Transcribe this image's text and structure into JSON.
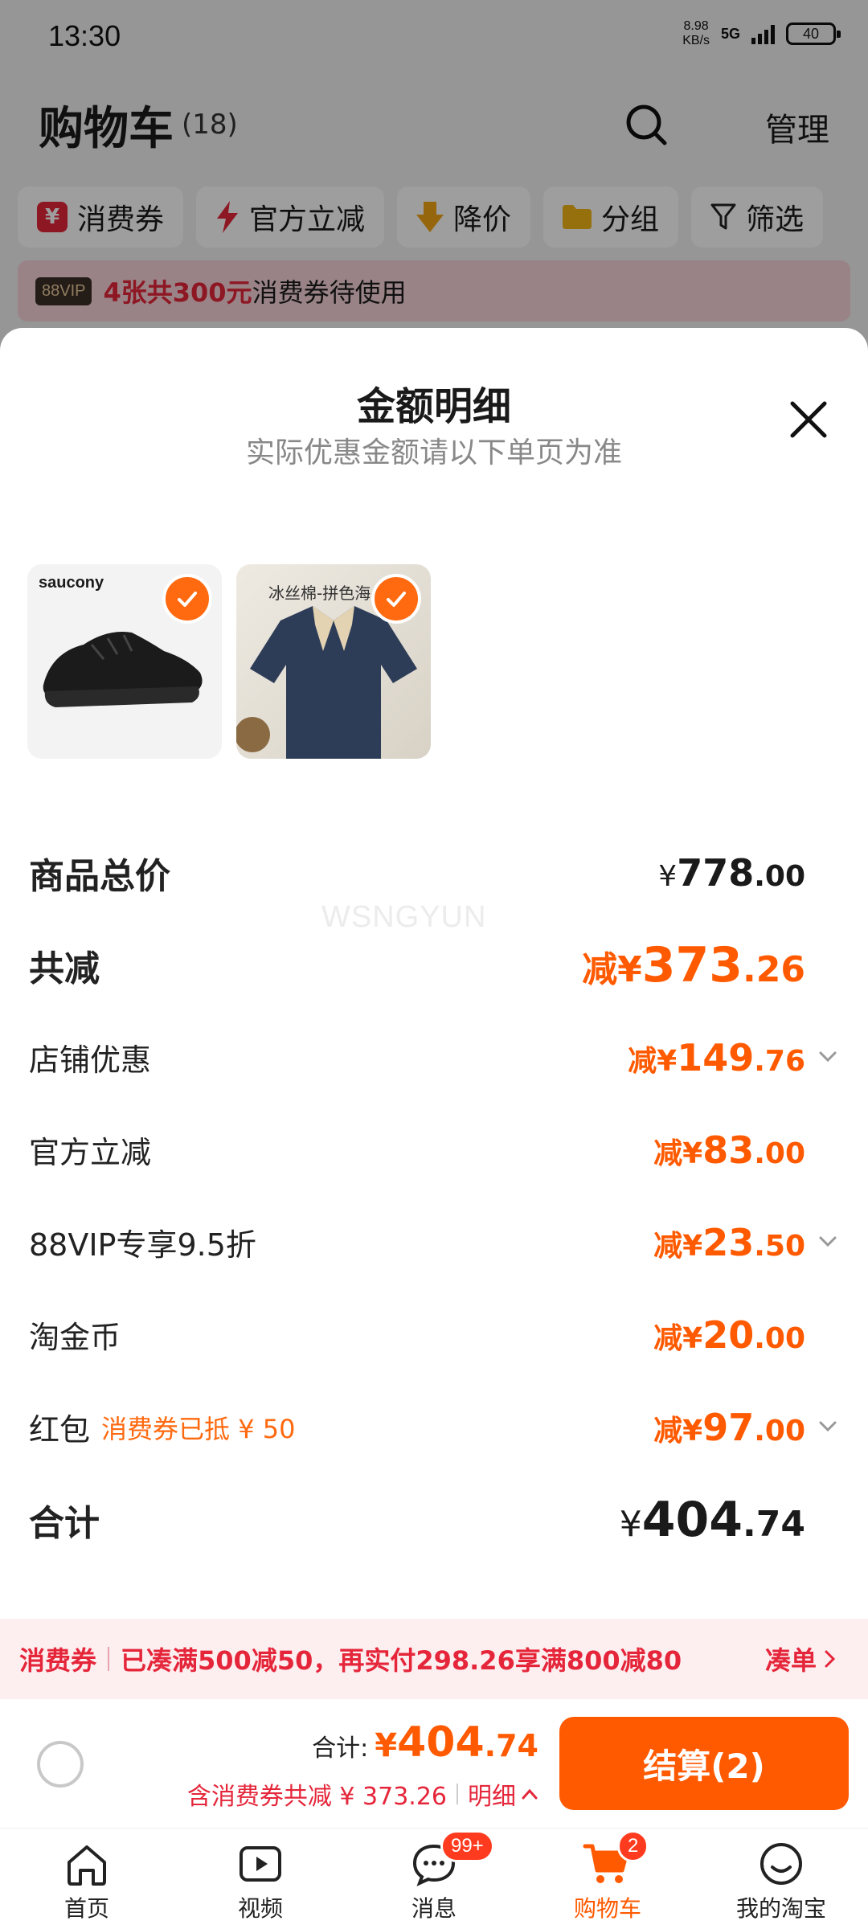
{
  "status_bar": {
    "time": "13:30",
    "net_speed_line1": "8.98",
    "net_speed_line2": "KB/s",
    "network": "5G",
    "battery": "40"
  },
  "cart_header": {
    "title": "购物车",
    "count": "(18)",
    "manage_label": "管理"
  },
  "filters": [
    {
      "label": "消费券",
      "icon": "coupon-yen-icon",
      "color": "#e5263a"
    },
    {
      "label": "官方立减",
      "icon": "lightning-icon",
      "color": "#e5263a"
    },
    {
      "label": "降价",
      "icon": "down-arrow-icon",
      "color": "#f2a516"
    },
    {
      "label": "分组",
      "icon": "folder-icon",
      "color": "#f2b516"
    },
    {
      "label": "筛选",
      "icon": "filter-funnel-icon",
      "color": "#222222"
    }
  ],
  "vip_banner": {
    "tag": "88VIP",
    "highlight": "4张共300元",
    "text": "消费券待使用"
  },
  "sheet": {
    "title": "金额明细",
    "subtitle": "实际优惠金额请以下单页为准",
    "products": [
      {
        "name": "saucony black running shoes",
        "brand": "saucony",
        "checked": true
      },
      {
        "name": "navy polo shirt",
        "label": "冰丝棉-拼色海",
        "checked": true
      }
    ],
    "rows": [
      {
        "label": "商品总价",
        "prefix": "¥",
        "int": "778",
        "dec": ".00"
      },
      {
        "label": "共减",
        "prefix": "减¥",
        "int": "373",
        "dec": ".26"
      },
      {
        "label": "店铺优惠",
        "prefix": "减¥",
        "int": "149",
        "dec": ".76"
      },
      {
        "label": "官方立减",
        "prefix": "减¥",
        "int": "83",
        "dec": ".00"
      },
      {
        "label": "88VIP专享9.5折",
        "prefix": "减¥",
        "int": "23",
        "dec": ".50"
      },
      {
        "label": "淘金币",
        "prefix": "减¥",
        "int": "20",
        "dec": ".00"
      },
      {
        "label": "红包",
        "note": "消费券已抵 ¥ 50",
        "prefix": "减¥",
        "int": "97",
        "dec": ".00"
      },
      {
        "label": "合计",
        "prefix": "¥",
        "int": "404",
        "dec": ".74"
      }
    ],
    "watermark": "WSNGYUN"
  },
  "coupon_bar": {
    "tag": "消费券",
    "text": "已凑满500减50，再实付298.26享满800减80",
    "link": "凑单"
  },
  "checkout": {
    "total_label": "合计:",
    "total_prefix": "¥",
    "total_int": "404",
    "total_dec": ".74",
    "discount_text": "含消费券共减 ¥ 373.26",
    "detail_label": "明细",
    "button_label": "结算(2)"
  },
  "tabbar": [
    {
      "label": "首页",
      "icon": "home-icon",
      "active": false
    },
    {
      "label": "视频",
      "icon": "video-play-icon",
      "active": false
    },
    {
      "label": "消息",
      "icon": "message-bubble-icon",
      "active": false,
      "badge": "99+"
    },
    {
      "label": "购物车",
      "icon": "shopping-cart-icon",
      "active": true,
      "badge": "2"
    },
    {
      "label": "我的淘宝",
      "icon": "smiley-profile-icon",
      "active": false
    }
  ],
  "colors": {
    "accent": "#ff5a00",
    "coupon_red": "#e5263a"
  }
}
